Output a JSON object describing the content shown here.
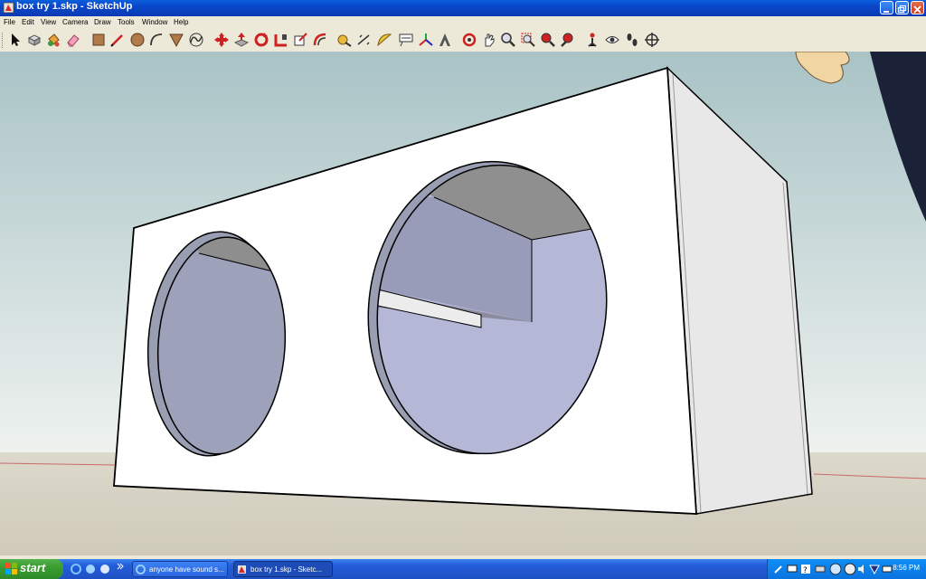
{
  "window": {
    "title": "box try 1.skp - SketchUp"
  },
  "menu": [
    "File",
    "Edit",
    "View",
    "Camera",
    "Draw",
    "Tools",
    "Window",
    "Help"
  ],
  "toolbar_icons": [
    "select-arrow-icon",
    "make-component-icon",
    "paint-bucket-icon",
    "eraser-icon",
    "rectangle-icon",
    "line-pencil-icon",
    "circle-icon",
    "arc-icon",
    "polygon-icon",
    "freehand-icon",
    "move-icon",
    "push-pull-icon",
    "rotate-icon",
    "follow-me-icon",
    "scale-icon",
    "offset-icon",
    "tape-measure-icon",
    "dimension-icon",
    "protractor-icon",
    "text-icon",
    "axes-icon",
    "3d-text-icon",
    "orbit-icon",
    "pan-icon",
    "zoom-icon",
    "zoom-window-icon",
    "zoom-extents-icon",
    "previous-view-icon",
    "position-camera-icon",
    "look-around-icon",
    "walk-icon",
    "section-plane-icon"
  ],
  "taskbar": {
    "start_label": "start",
    "tasks": [
      {
        "label": "anyone have sound s...",
        "icon": "ie-icon",
        "active": false
      },
      {
        "label": "box try 1.skp - Sketc...",
        "icon": "sketchup-icon",
        "active": true
      }
    ],
    "clock": "8:56 PM"
  }
}
